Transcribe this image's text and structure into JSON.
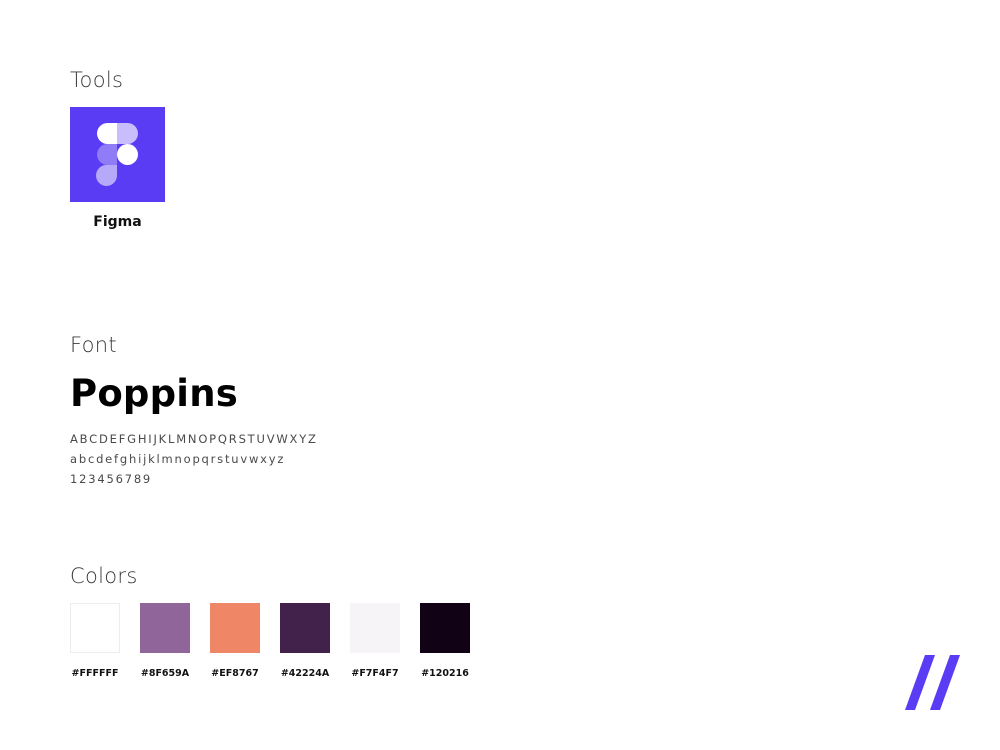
{
  "tools": {
    "title": "Tools",
    "items": [
      {
        "label": "Figma",
        "icon": "figma-logo-icon",
        "tile_color": "#5A3CF4"
      }
    ]
  },
  "font": {
    "title": "Font",
    "name": "Poppins",
    "uppercase": "ABCDEFGHIJKLMNOPQRSTUVWXYZ",
    "lowercase": "abcdefghijklmnopqrstuvwxyz",
    "digits": "123456789"
  },
  "colors": {
    "title": "Colors",
    "swatches": [
      {
        "hex": "#FFFFFF",
        "label": "#FFFFFF"
      },
      {
        "hex": "#8F659A",
        "label": "#8F659A"
      },
      {
        "hex": "#EF8767",
        "label": "#EF8767"
      },
      {
        "hex": "#42224A",
        "label": "#42224A"
      },
      {
        "hex": "#F7F4F7",
        "label": "#F7F4F7"
      },
      {
        "hex": "#120216",
        "label": "#120216"
      }
    ]
  },
  "brand": {
    "icon": "double-slash-logo-icon",
    "color": "#5A3CF4"
  }
}
